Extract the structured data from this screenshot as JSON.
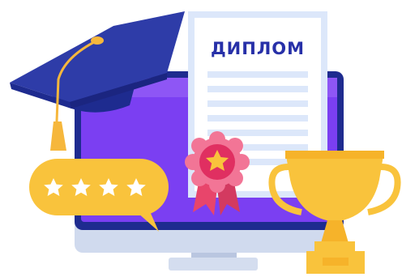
{
  "diploma": {
    "title": "ДИПЛОМ"
  },
  "rating": {
    "stars": 4,
    "max_stars": 4
  },
  "icons": {
    "graduation_cap": "graduation-cap-icon",
    "rosette": "award-rosette-icon",
    "trophy": "trophy-icon",
    "star": "star-icon",
    "monitor": "monitor-icon"
  },
  "colors": {
    "monitor_frame": "#1E2B8F",
    "monitor_screen": "#7B3FF2",
    "monitor_stand": "#C7D3EA",
    "diploma_paper": "#FFFFFF",
    "diploma_lines": "#DCE7FA",
    "diploma_title": "#2730A8",
    "cap": "#2E3CA8",
    "tassel": "#F6B73C",
    "rosette": "#E8456B",
    "bubble": "#F9C33C",
    "trophy": "#F9C33C"
  }
}
